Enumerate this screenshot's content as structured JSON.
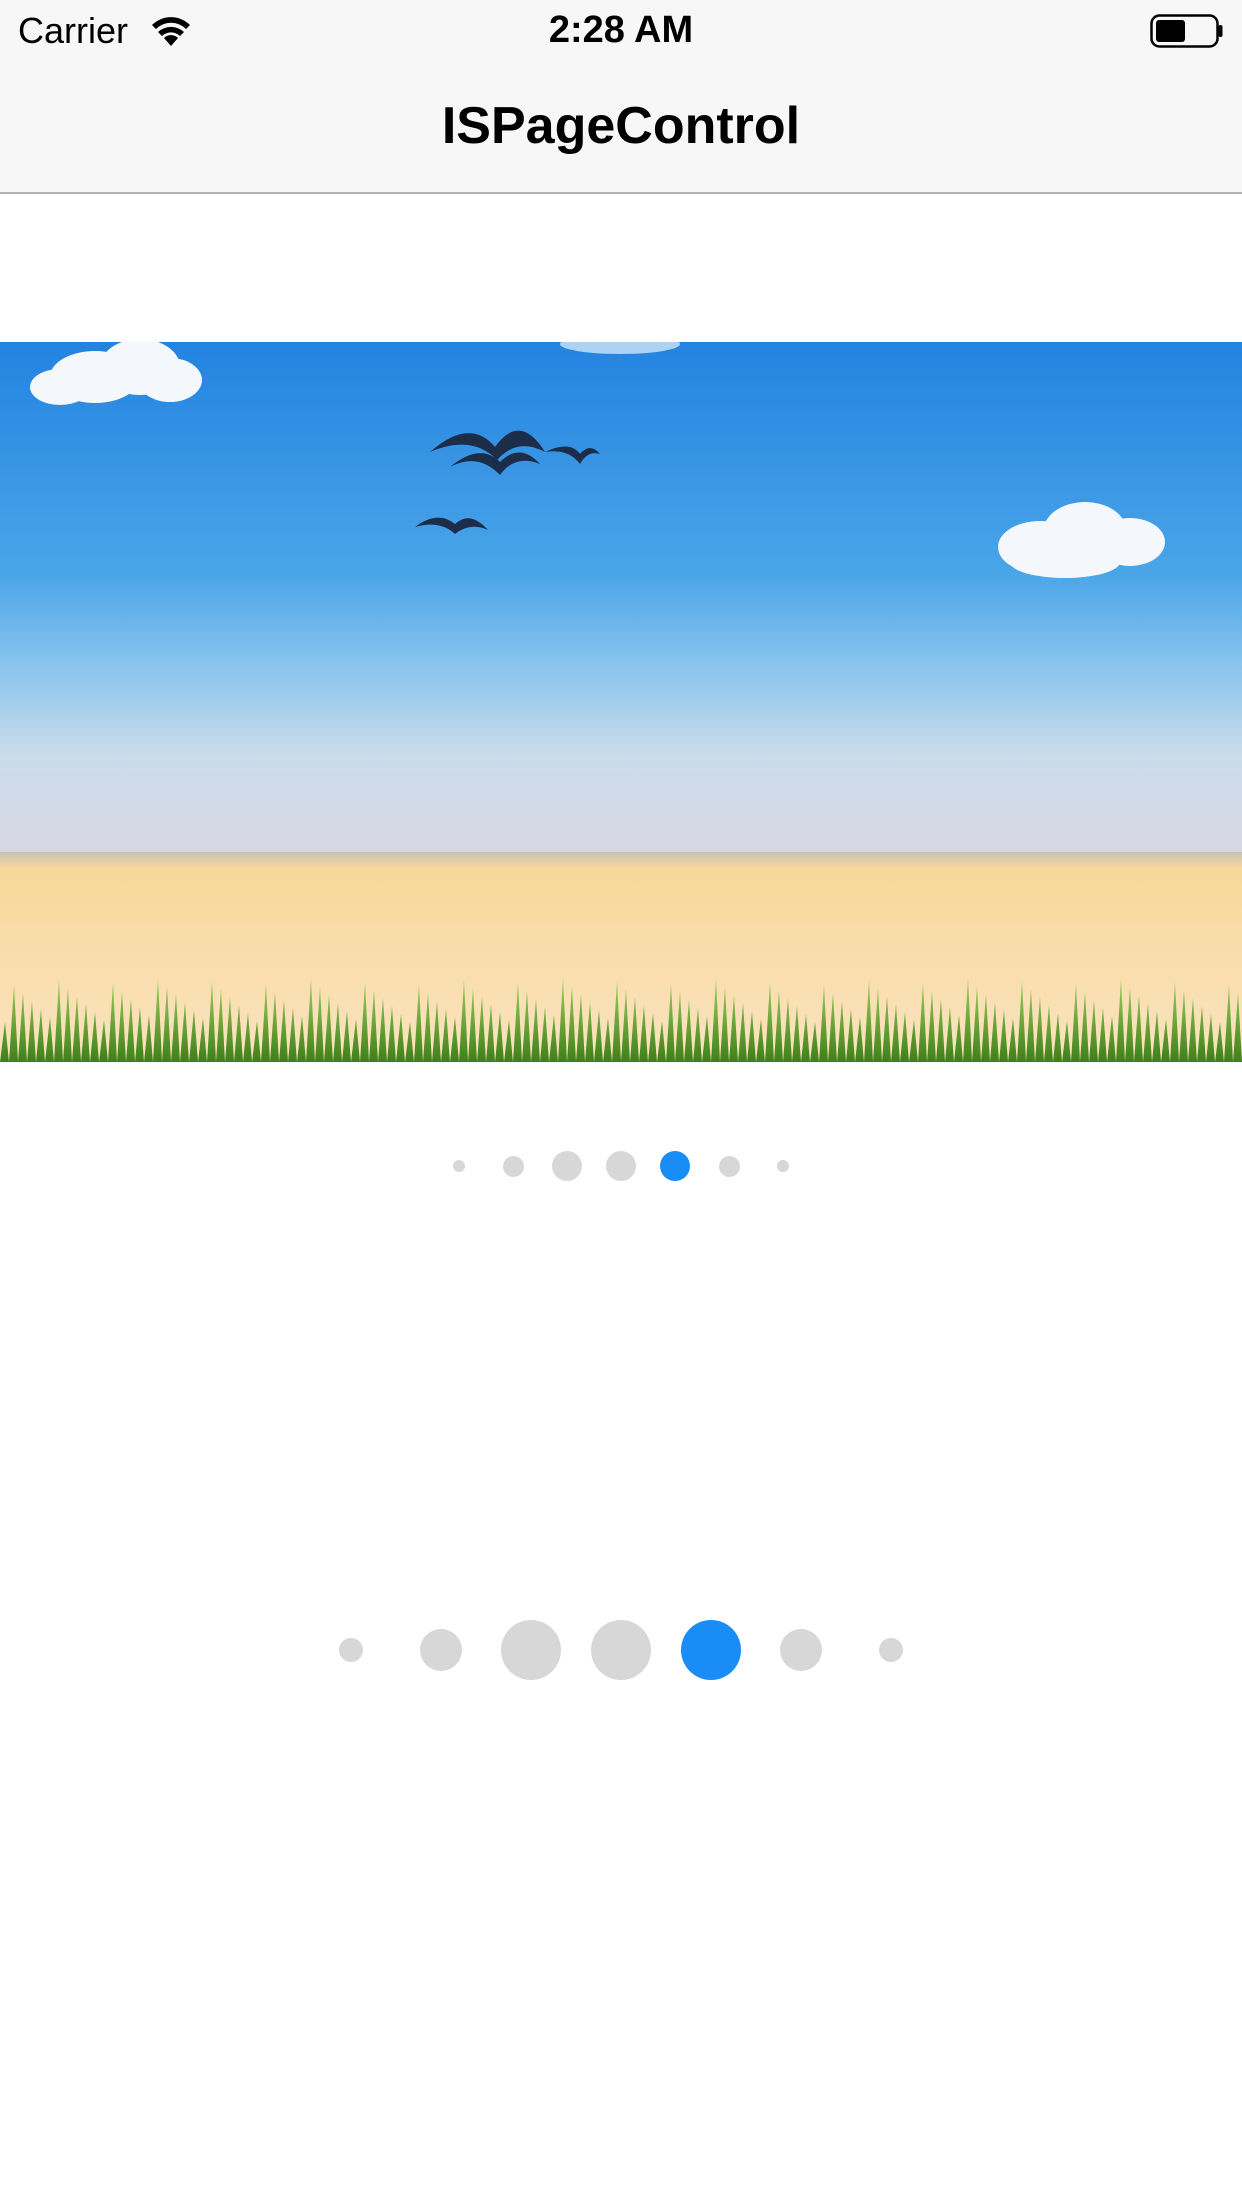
{
  "status_bar": {
    "carrier": "Carrier",
    "time": "2:28 AM",
    "icons": [
      "wifi-icon",
      "battery-icon"
    ],
    "battery_level": 0.5
  },
  "nav_bar": {
    "title": "ISPageControl"
  },
  "banner": {
    "description_icons": [
      "cloud-icon",
      "bird-icon",
      "grass-icon"
    ]
  },
  "page_controls": [
    {
      "page_count": 7,
      "current_page": 5
    },
    {
      "page_count": 7,
      "current_page": 5
    }
  ],
  "colors": {
    "active_dot": "#1a8cf5",
    "inactive_dot": "#d7d7d7",
    "bar_background": "#f7f7f7",
    "sky_top": "#2383e0",
    "sky_bottom": "#d6d6e6",
    "sand": "#fad9a4",
    "grass": "#5c9e2a"
  }
}
